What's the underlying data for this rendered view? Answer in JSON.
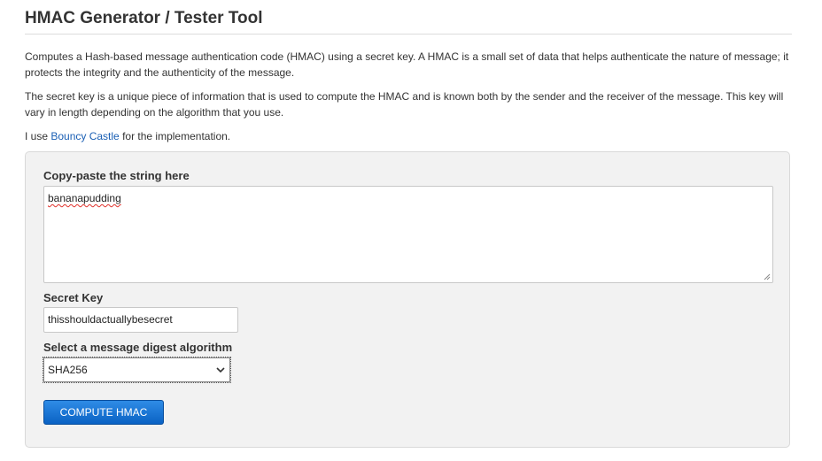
{
  "page": {
    "title": "HMAC Generator / Tester Tool",
    "description_1": "Computes a Hash-based message authentication code (HMAC) using a secret key. A HMAC is a small set of data that helps authenticate the nature of message; it protects the integrity and the authenticity of the message.",
    "description_2": "The secret key is a unique piece of information that is used to compute the HMAC and is known both by the sender and the receiver of the message. This key will vary in length depending on the algorithm that you use.",
    "implementation_prefix": "I use ",
    "implementation_link": "Bouncy Castle",
    "implementation_suffix": " for the implementation."
  },
  "form": {
    "input_label": "Copy-paste the string here",
    "input_value": "bananapudding",
    "secret_key_label": "Secret Key",
    "secret_key_value": "thisshouldactuallybesecret",
    "algorithm_label": "Select a message digest algorithm",
    "algorithm_selected": "SHA256",
    "compute_label": "COMPUTE HMAC"
  },
  "colors": {
    "link": "#1a5fb4",
    "button": "#0a62c4",
    "panel_background": "#f2f2f2"
  },
  "icons": {
    "select": "chevron-down-icon",
    "textarea": "resize-grip-icon"
  }
}
